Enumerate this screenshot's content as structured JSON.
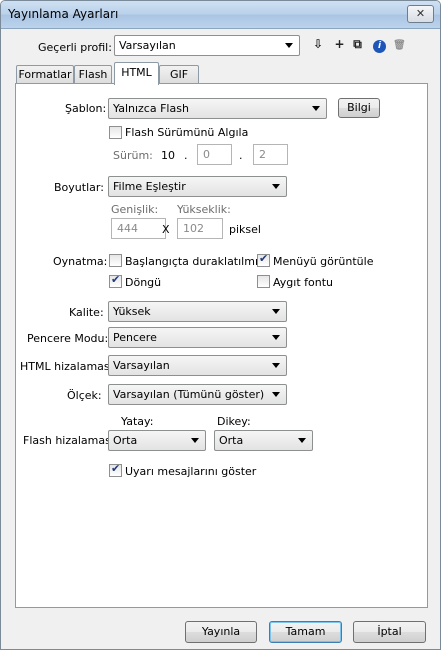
{
  "window": {
    "title": "Yayınlama Ayarları"
  },
  "profile": {
    "label": "Geçerli profil:",
    "value": "Varsayılan",
    "toolbar": {
      "import_export": "⇩",
      "add": "+",
      "duplicate": "⧉",
      "info": "i",
      "delete": "🗑"
    }
  },
  "tabs": [
    {
      "label": "Formatlar"
    },
    {
      "label": "Flash"
    },
    {
      "label": "HTML"
    },
    {
      "label": "GIF"
    }
  ],
  "template": {
    "label": "Şablon:",
    "value": "Yalnızca Flash",
    "info_button": "Bilgi",
    "detect_flash_label": "Flash Sürümünü Algıla",
    "version_label": "Sürüm:",
    "version_major": "10",
    "dot1": ".",
    "version_minor": "0",
    "dot2": ".",
    "version_rev": "2"
  },
  "dimensions": {
    "label": "Boyutlar:",
    "value": "Filme Eşleştir",
    "width_label": "Genişlik:",
    "height_label": "Yükseklik:",
    "width_value": "444",
    "x_label": "X",
    "height_value": "102",
    "unit": "piksel"
  },
  "playback": {
    "label": "Oynatma:",
    "paused_label": "Başlangıçta duraklatılmış",
    "paused_checked": false,
    "menu_label": "Menüyü görüntüle",
    "menu_checked": true,
    "loop_label": "Döngü",
    "loop_checked": true,
    "device_font_label": "Aygıt fontu",
    "device_font_checked": false
  },
  "quality": {
    "label": "Kalite:",
    "value": "Yüksek"
  },
  "window_mode": {
    "label": "Pencere Modu:",
    "value": "Pencere"
  },
  "html_align": {
    "label": "HTML hizalaması:",
    "value": "Varsayılan"
  },
  "scale": {
    "label": "Ölçek:",
    "value": "Varsayılan (Tümünü göster)"
  },
  "flash_align": {
    "label": "Flash hizalaması:",
    "horizontal_label": "Yatay:",
    "horizontal_value": "Orta",
    "vertical_label": "Dikey:",
    "vertical_value": "Orta"
  },
  "warnings": {
    "label": "Uyarı mesajlarını göster",
    "checked": true
  },
  "footer": {
    "publish": "Yayınla",
    "ok": "Tamam",
    "cancel": "İptal"
  }
}
